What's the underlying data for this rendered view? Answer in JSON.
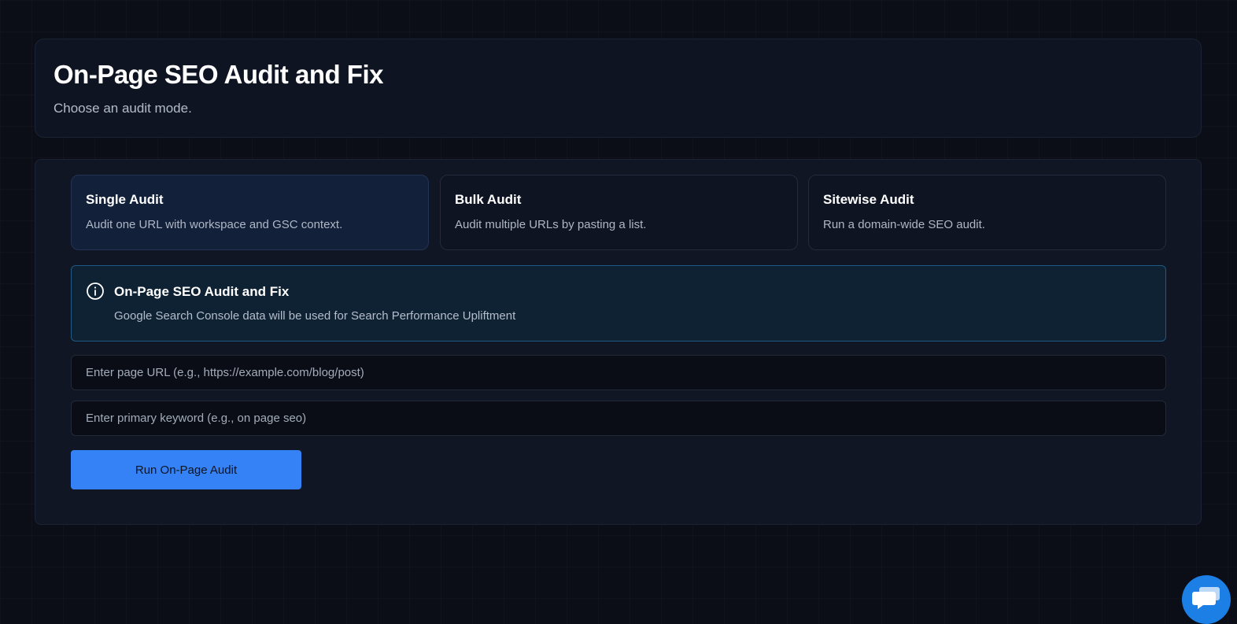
{
  "header": {
    "title": "On-Page SEO Audit and Fix",
    "subtitle": "Choose an audit mode."
  },
  "modes": [
    {
      "title": "Single Audit",
      "description": "Audit one URL with workspace and GSC context.",
      "active": true
    },
    {
      "title": "Bulk Audit",
      "description": "Audit multiple URLs by pasting a list.",
      "active": false
    },
    {
      "title": "Sitewise Audit",
      "description": "Run a domain-wide SEO audit.",
      "active": false
    }
  ],
  "info": {
    "icon": "info-icon",
    "title": "On-Page SEO Audit and Fix",
    "description": "Google Search Console data will be used for Search Performance Upliftment"
  },
  "form": {
    "url_value": "",
    "url_placeholder": "Enter page URL (e.g., https://example.com/blog/post)",
    "keyword_value": "",
    "keyword_placeholder": "Enter primary keyword (e.g., on page seo)",
    "submit_label": "Run On-Page Audit"
  },
  "chat_widget": {
    "icon": "chat-bubbles-icon"
  },
  "colors": {
    "accent": "#3482f6",
    "background": "#0b0e16",
    "card": "#111624",
    "info_border": "#1f5a82",
    "chat": "#1c7fe6"
  }
}
